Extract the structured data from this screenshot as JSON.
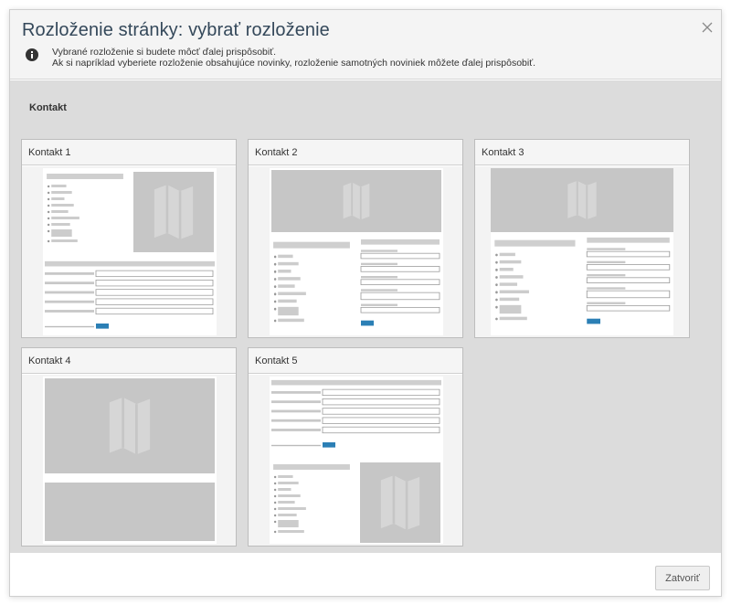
{
  "dialog": {
    "title": "Rozloženie stránky: vybrať rozloženie",
    "close_icon": "close-icon",
    "info_icon": "info-icon",
    "info_line1": "Vybrané rozloženie si budete môcť ďalej prispôsobiť.",
    "info_line2": "Ak si napríklad vyberiete rozloženie obsahujúce novinky, rozloženie samotných noviniek môžete ďalej prispôsobiť."
  },
  "section": {
    "title": "Kontakt"
  },
  "layouts": [
    {
      "label": "Kontakt 1"
    },
    {
      "label": "Kontakt 2"
    },
    {
      "label": "Kontakt 3"
    },
    {
      "label": "Kontakt 4"
    },
    {
      "label": "Kontakt 5"
    }
  ],
  "footer": {
    "close_label": "Zatvoriť"
  },
  "colors": {
    "title": "#34485a",
    "placeholder": "#c8c8c8",
    "submit": "#2b7fb5",
    "backdrop": "#dcdcdc"
  }
}
